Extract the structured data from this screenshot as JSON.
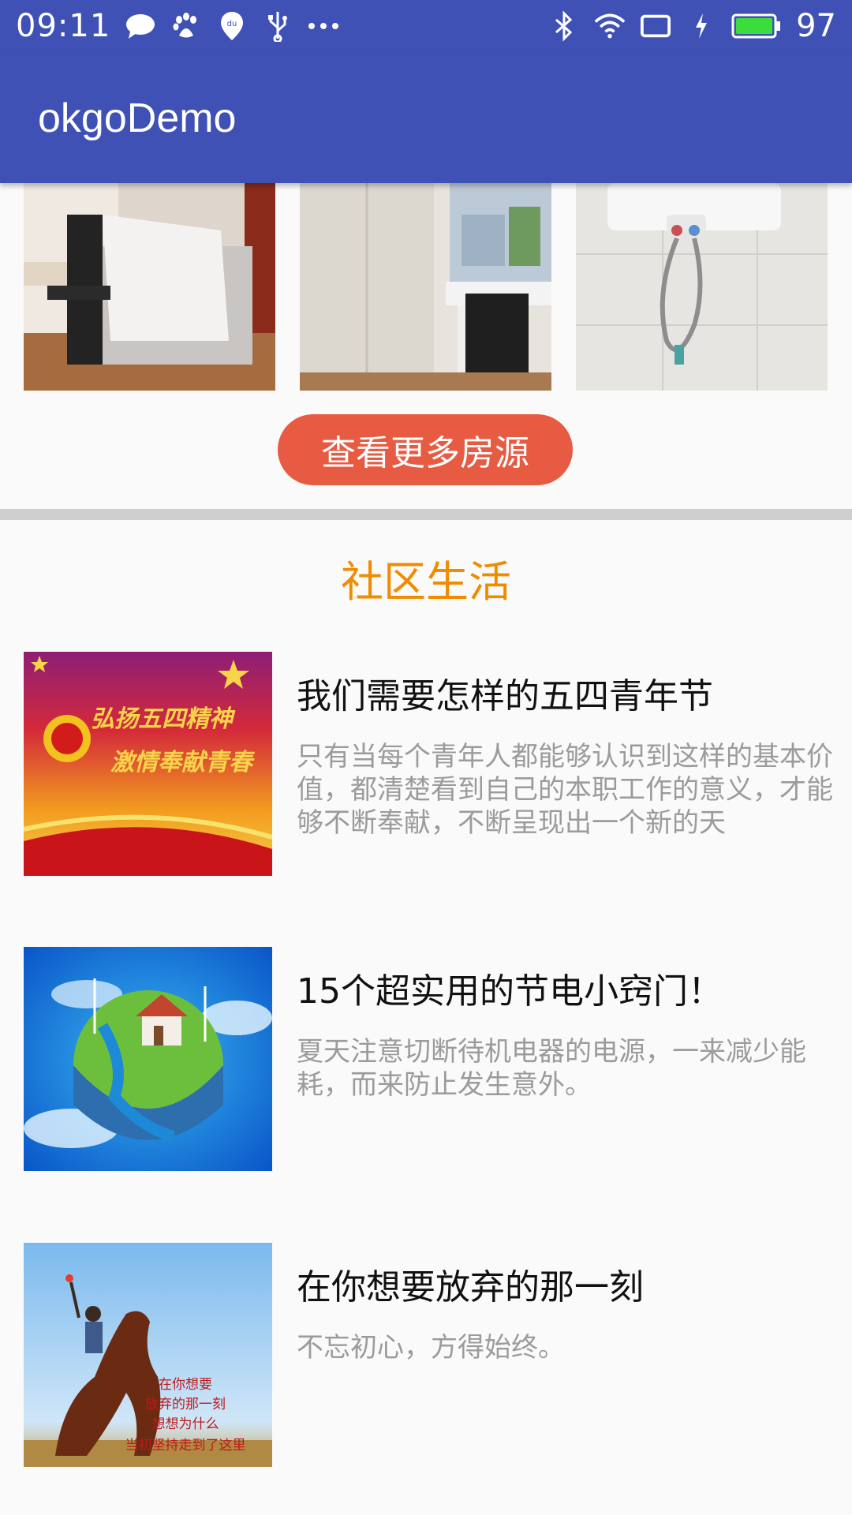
{
  "status_bar": {
    "time": "09:11",
    "battery_level": "97",
    "icons": [
      "message-icon",
      "baidu-paw-icon",
      "location-pin-icon",
      "usb-icon",
      "more-dots-icon",
      "bluetooth-icon",
      "wifi-icon",
      "screen-rotate-icon",
      "charging-icon",
      "battery-icon"
    ]
  },
  "toolbar": {
    "title": "okgoDemo"
  },
  "rooms": {
    "photos": [
      "bedroom-photo",
      "desk-room-photo",
      "bathroom-photo"
    ],
    "more_button_label": "查看更多房源"
  },
  "community": {
    "section_title": "社区生活",
    "articles": [
      {
        "title": "我们需要怎样的五四青年节",
        "description": "只有当每个青年人都能够认识到这样的基本价值，都清楚看到自己的本职工作的意义，才能够不断奉献，不断呈现出一个新的天",
        "thumb_text_1": "弘扬五四精神",
        "thumb_text_2": "激情奉献青春"
      },
      {
        "title": "15个超实用的节电小窍门！",
        "description": "夏天注意切断待机电器的电源，一来减少能耗，而来防止发生意外。"
      },
      {
        "title": "在你想要放弃的那一刻",
        "description": "不忘初心，方得始终。",
        "thumb_lines": [
          "在你想要",
          "放弃的那一刻",
          "想想为什么",
          "当初坚持走到了这里"
        ]
      }
    ]
  },
  "colors": {
    "primary": "#3f51b5",
    "accent_button": "#e75b43",
    "section_title": "#f08c00",
    "description_text": "#9b9b9b"
  }
}
